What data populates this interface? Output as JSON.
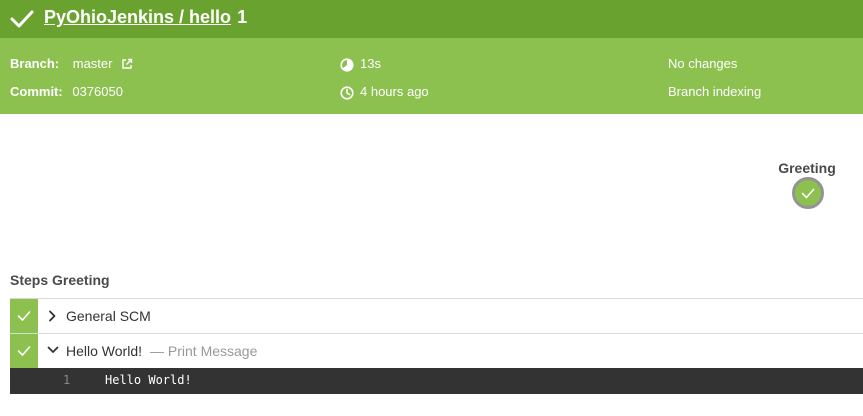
{
  "header": {
    "pipeline_link": "PyOhioJenkins / hello",
    "run_number": "1",
    "status_icon": "check-icon"
  },
  "info": {
    "branch_label": "Branch:",
    "branch_value": "master",
    "commit_label": "Commit:",
    "commit_value": "0376050",
    "duration": "13s",
    "started": "4 hours ago",
    "changes": "No changes",
    "cause": "Branch indexing"
  },
  "graph": {
    "stage_name": "Greeting",
    "stage_status": "success"
  },
  "steps": {
    "heading": "Steps Greeting",
    "items": [
      {
        "name": "General SCM",
        "sub": "",
        "expanded": false,
        "status": "success"
      },
      {
        "name": "Hello World!",
        "sub": "— Print Message",
        "expanded": true,
        "status": "success"
      }
    ],
    "log": [
      {
        "line": "1",
        "text": "Hello World!"
      }
    ]
  },
  "colors": {
    "header_green": "#6aa22f",
    "info_green": "#8cc04f",
    "log_bg": "#333333"
  }
}
